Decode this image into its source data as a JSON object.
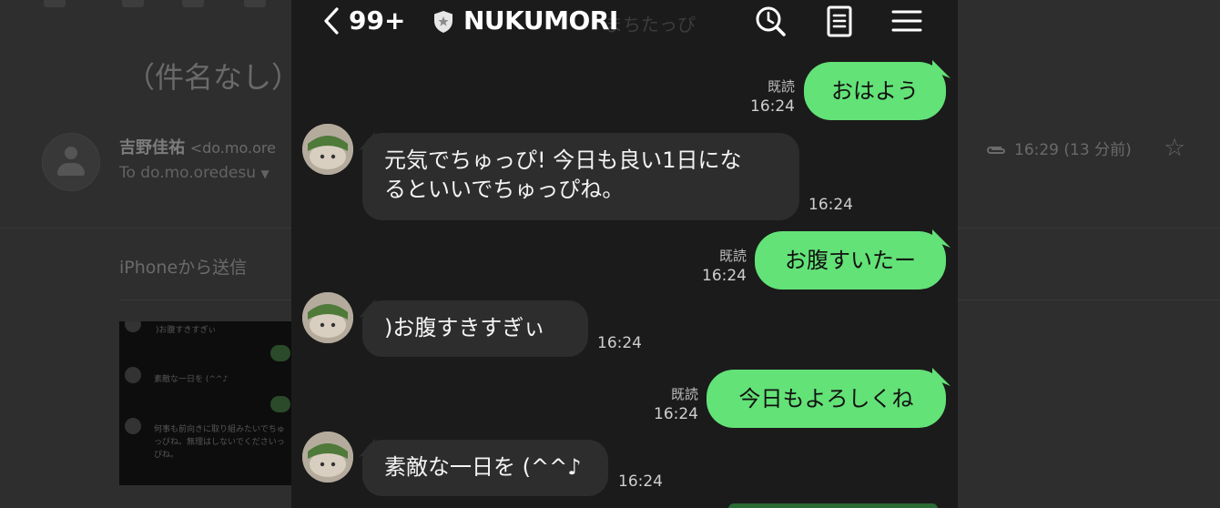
{
  "email": {
    "subject": "（件名なし）",
    "sender_name": "吉野佳祐",
    "sender_address": "<do.mo.ore",
    "to_line": "To do.mo.oredesu",
    "time": "16:29 (13 分前)",
    "body_text": "iPhoneから送信",
    "thumbnail_lines": [
      ")お腹すきすぎぃ",
      "素敵な一日を (^^♪",
      "何事も前向きに取り組みたいでちゅっぴね。無理はしないでくださいっぴね。"
    ]
  },
  "chat": {
    "header": {
      "unread_count": "99+",
      "room_name": "NUKUMORI",
      "ghost_title": "まちたっぴ"
    },
    "read_label": "既読",
    "messages": [
      {
        "side": "out",
        "text": "おはよう",
        "time": "16:24",
        "read": true
      },
      {
        "side": "in",
        "lines": [
          "元気でちゅっぴ! 今日も良い1日にな",
          "るといいでちゅっぴね。"
        ],
        "time": "16:24"
      },
      {
        "side": "out",
        "text": "お腹すいたー",
        "time": "16:24",
        "read": true
      },
      {
        "side": "in",
        "lines": [
          ")お腹すきすぎぃ"
        ],
        "time": "16:24"
      },
      {
        "side": "out",
        "text": "今日もよろしくね",
        "time": "16:24",
        "read": true
      },
      {
        "side": "in",
        "lines": [
          "素敵な一日を (^^♪"
        ],
        "time": "16:24"
      }
    ],
    "colors": {
      "background": "#1b1b1b",
      "outgoing_bubble": "#63e277",
      "incoming_bubble": "#2d2d2d"
    },
    "icons": [
      "back-chevron-icon",
      "shield-icon",
      "search-icon",
      "notes-icon",
      "menu-icon"
    ]
  }
}
